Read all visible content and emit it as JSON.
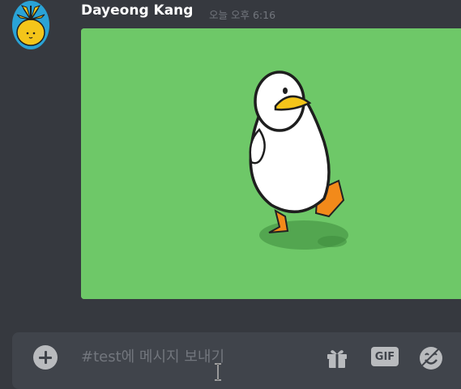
{
  "message": {
    "author": "Dayeong Kang",
    "timestamp": "오늘 오후 6:16",
    "attachment_bg": "#6ec868"
  },
  "composer": {
    "placeholder": "#test에 메시지 보내기",
    "gif_label": "GIF",
    "icons": [
      "add-circle-icon",
      "gift-icon",
      "emoji-icon"
    ]
  },
  "colors": {
    "background": "#36393f",
    "composer": "#40444b",
    "username": "#ffffff",
    "timestamp": "#72767d"
  }
}
